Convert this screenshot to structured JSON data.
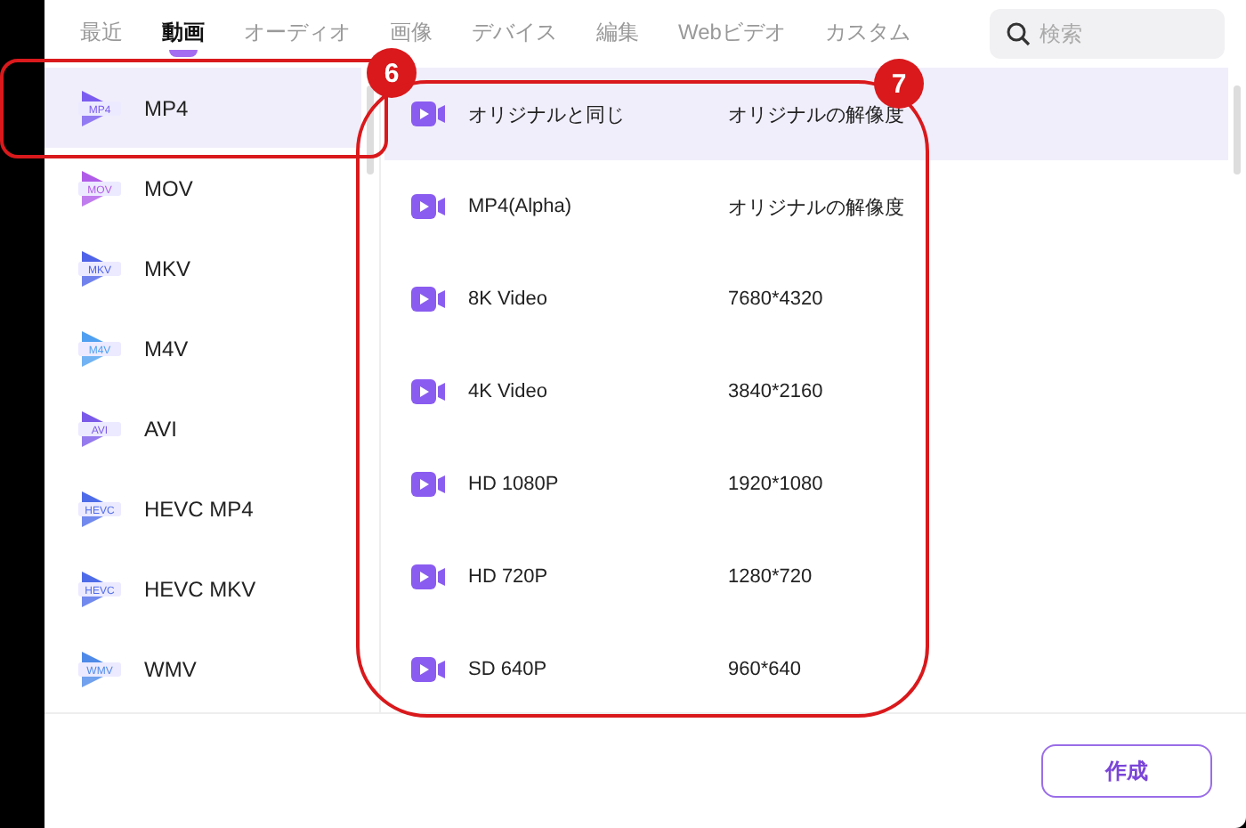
{
  "tabs": [
    {
      "label": "最近",
      "selected": false
    },
    {
      "label": "動画",
      "selected": true
    },
    {
      "label": "オーディオ",
      "selected": false
    },
    {
      "label": "画像",
      "selected": false
    },
    {
      "label": "デバイス",
      "selected": false
    },
    {
      "label": "編集",
      "selected": false
    },
    {
      "label": "Webビデオ",
      "selected": false
    },
    {
      "label": "カスタム",
      "selected": false
    }
  ],
  "search": {
    "placeholder": "検索"
  },
  "formats": [
    {
      "name": "MP4",
      "icon_text": "MP4",
      "color": "#7b5cf0",
      "selected": true
    },
    {
      "name": "MOV",
      "icon_text": "MOV",
      "color": "#b05ce8",
      "selected": false
    },
    {
      "name": "MKV",
      "icon_text": "MKV",
      "color": "#4f63e8",
      "selected": false
    },
    {
      "name": "M4V",
      "icon_text": "M4V",
      "color": "#4fa0f0",
      "selected": false
    },
    {
      "name": "AVI",
      "icon_text": "AVI",
      "color": "#7a5ae8",
      "selected": false
    },
    {
      "name": "HEVC MP4",
      "icon_text": "HEVC",
      "color": "#4f6ce8",
      "selected": false
    },
    {
      "name": "HEVC MKV",
      "icon_text": "HEVC",
      "color": "#4f6ce8",
      "selected": false
    },
    {
      "name": "WMV",
      "icon_text": "WMV",
      "color": "#4f8ae8",
      "selected": false
    }
  ],
  "presets": [
    {
      "name": "オリジナルと同じ",
      "resolution": "オリジナルの解像度",
      "selected": true
    },
    {
      "name": "MP4(Alpha)",
      "resolution": "オリジナルの解像度",
      "selected": false
    },
    {
      "name": "8K Video",
      "resolution": "7680*4320",
      "selected": false
    },
    {
      "name": "4K Video",
      "resolution": "3840*2160",
      "selected": false
    },
    {
      "name": "HD 1080P",
      "resolution": "1920*1080",
      "selected": false
    },
    {
      "name": "HD 720P",
      "resolution": "1280*720",
      "selected": false
    },
    {
      "name": "SD 640P",
      "resolution": "960*640",
      "selected": false
    }
  ],
  "create_button": "作成",
  "annotations": [
    {
      "label": "6"
    },
    {
      "label": "7"
    }
  ]
}
